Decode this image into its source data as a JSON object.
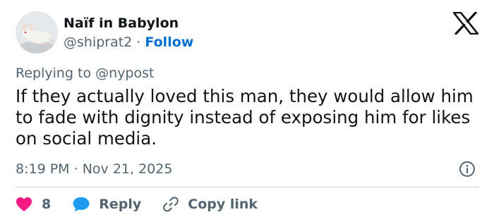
{
  "author": {
    "name": "Naïf in Babylon",
    "handle": "@shiprat2",
    "separator": "·",
    "follow_label": "Follow"
  },
  "reply_context": {
    "text": "Replying to @nypost"
  },
  "tweet": {
    "text": "If they actually loved this man, they would allow him to fade with dignity instead of exposing him for likes on social media.",
    "time": "8:19 PM",
    "separator": "·",
    "date": "Nov 21, 2025"
  },
  "actions": {
    "like_count": "8",
    "reply_label": "Reply",
    "copy_link_label": "Copy link"
  },
  "icons": {
    "logo": "x-logo-icon",
    "info": "info-icon",
    "like": "heart-icon",
    "reply": "speech-bubble-icon",
    "copy": "link-icon"
  },
  "colors": {
    "text_primary": "#0f1419",
    "text_secondary": "#536471",
    "follow": "#006fd6",
    "like": "#f91880",
    "reply": "#1d9bf0",
    "divider": "#cfd9de"
  }
}
